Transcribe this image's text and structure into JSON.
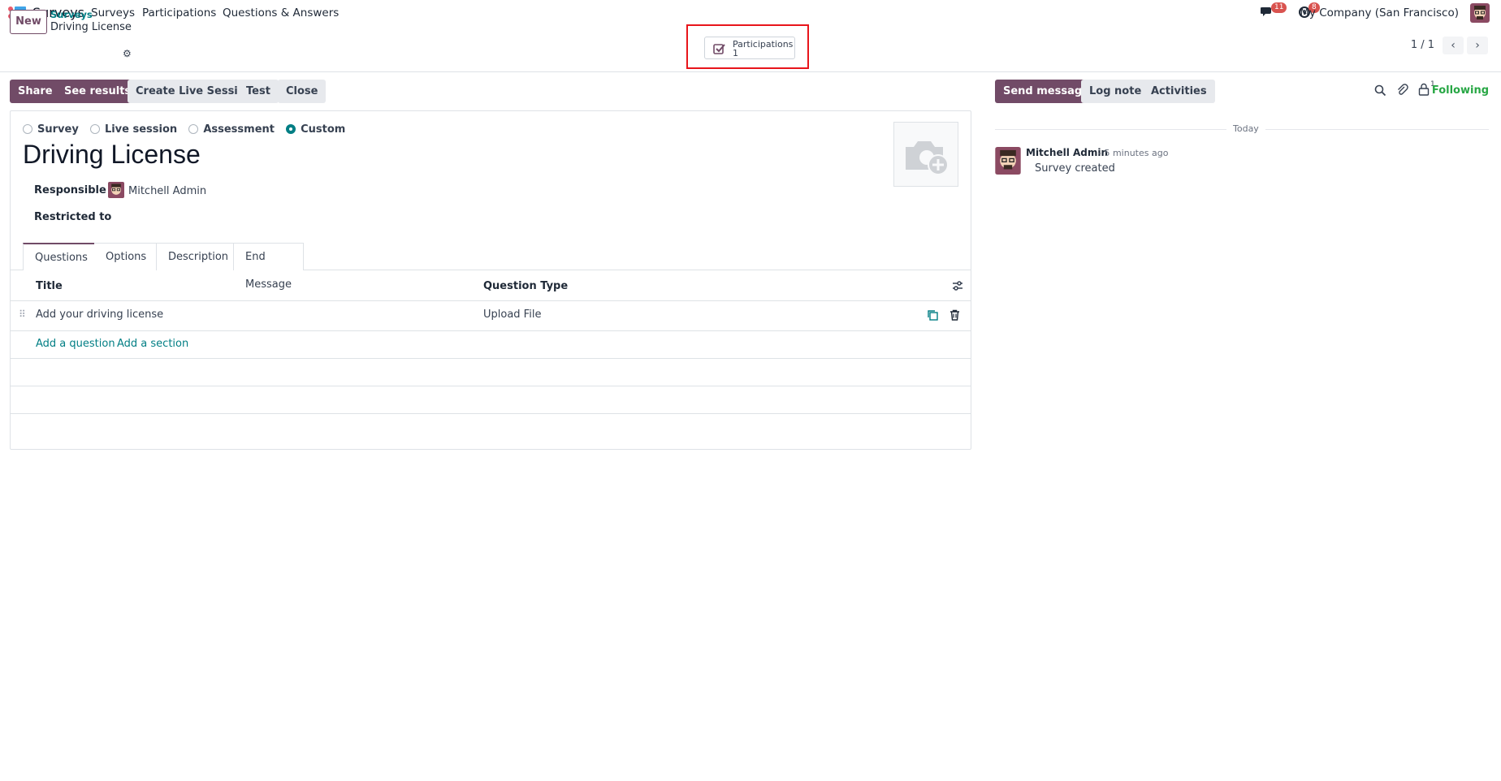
{
  "topnav": {
    "app_name": "Surveys",
    "menu": [
      "Surveys",
      "Participations",
      "Questions & Answers"
    ],
    "messages_count": "11",
    "activities_count": "8",
    "company": "My Company (San Francisco)"
  },
  "control": {
    "new_label": "New",
    "breadcrumb_parent": "Surveys",
    "breadcrumb_current": "Driving License",
    "smart_button": {
      "label": "Participations",
      "value": "1"
    },
    "pager": "1 / 1"
  },
  "actions": {
    "share": "Share",
    "see_results": "See results",
    "create_live": "Create Live Session",
    "test": "Test",
    "close": "Close"
  },
  "form": {
    "survey_types": [
      "Survey",
      "Live session",
      "Assessment",
      "Custom"
    ],
    "selected_type": "Custom",
    "title": "Driving License",
    "responsible_label": "Responsible",
    "responsible_value": "Mitchell Admin",
    "restricted_label": "Restricted to",
    "tabs": [
      "Questions",
      "Options",
      "Description",
      "End Message"
    ],
    "active_tab": "Questions",
    "columns": [
      "Title",
      "Question Type"
    ],
    "rows": [
      {
        "title": "Add your driving license",
        "type": "Upload File"
      }
    ],
    "add_question": "Add a question",
    "add_section": "Add a section"
  },
  "chatter": {
    "send_message": "Send message",
    "log_note": "Log note",
    "activities": "Activities",
    "followers_count": "1",
    "following": "Following",
    "date_separator": "Today",
    "messages": [
      {
        "author": "Mitchell Admin",
        "time": "- 5 minutes ago",
        "body": "Survey created"
      }
    ]
  },
  "colors": {
    "primary": "#714B67",
    "accent": "#017e84",
    "badge": "#d9534f",
    "highlight": "#e8151b"
  }
}
